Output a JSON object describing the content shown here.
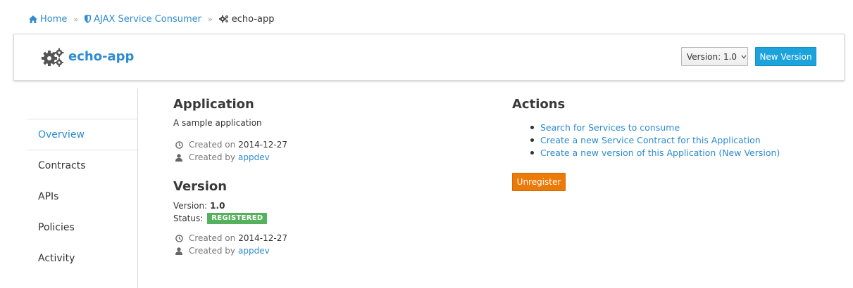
{
  "breadcrumb": {
    "items": [
      {
        "label": "Home",
        "icon": "home-icon"
      },
      {
        "label": "AJAX Service Consumer",
        "icon": "shield-icon"
      },
      {
        "label": "echo-app",
        "icon": "gears-icon"
      }
    ],
    "separator": "»"
  },
  "header": {
    "title": "echo-app",
    "icon": "gears-icon",
    "version_select_label": "Version: 1.0",
    "new_version_label": "New Version"
  },
  "sidenav": {
    "items": [
      {
        "label": "Overview",
        "active": true
      },
      {
        "label": "Contracts"
      },
      {
        "label": "APIs"
      },
      {
        "label": "Policies"
      },
      {
        "label": "Activity"
      }
    ]
  },
  "application": {
    "heading": "Application",
    "description": "A sample application",
    "created_on_label": "Created on",
    "created_on": "2014-12-27",
    "created_by_label": "Created by",
    "created_by": "appdev"
  },
  "version": {
    "heading": "Version",
    "version_label": "Version:",
    "version_value": "1.0",
    "status_label": "Status:",
    "status_value": "REGISTERED",
    "created_on_label": "Created on",
    "created_on": "2014-12-27",
    "created_by_label": "Created by",
    "created_by": "appdev"
  },
  "actions": {
    "heading": "Actions",
    "links": [
      "Search for Services to consume",
      "Create a new Service Contract for this Application",
      "Create a new version of this Application (New Version)"
    ],
    "unregister_label": "Unregister"
  },
  "colors": {
    "link": "#2e8bd0",
    "primary_button": "#1da3dc",
    "status_registered": "#56b15c",
    "unregister_button": "#ec7a08"
  }
}
